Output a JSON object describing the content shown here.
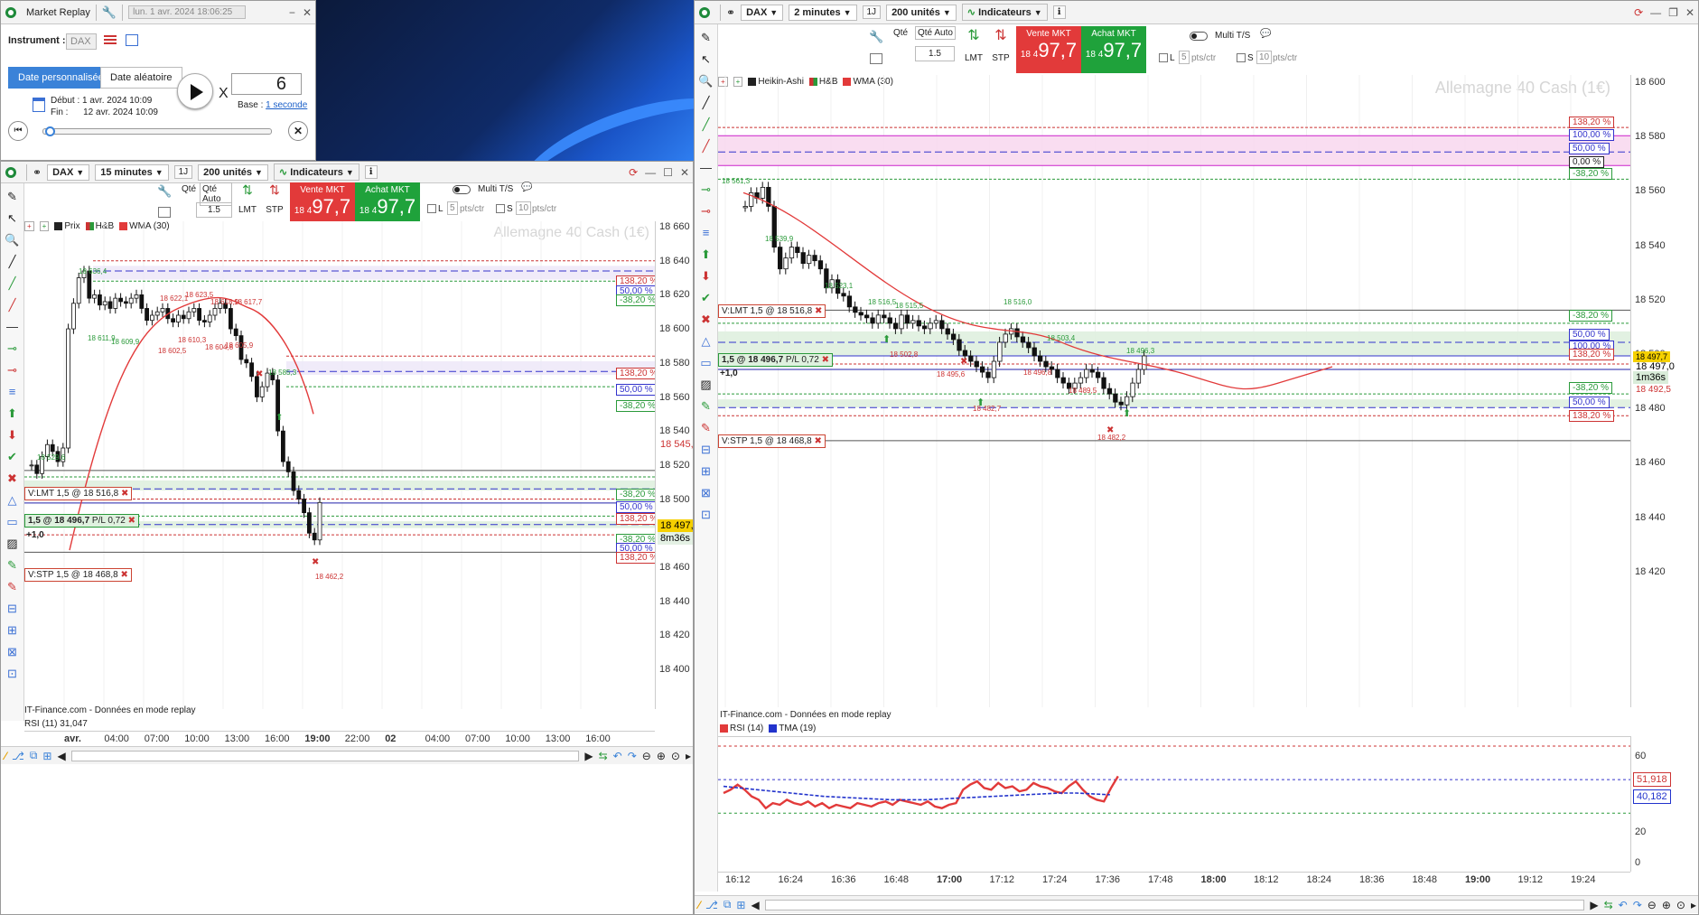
{
  "replay": {
    "title": "Market Replay",
    "datetime": "lun. 1 avr. 2024 18:06:25",
    "instrument_label": "Instrument :",
    "instrument_value": "DAX",
    "tab_custom": "Date personnalisée",
    "tab_random": "Date aléatoire",
    "speed_prefix": "X",
    "speed_value": "6",
    "start_label": "Début :",
    "start_value": "1 avr. 2024 10:09",
    "end_label": "Fin :",
    "end_value": "12 avr. 2024 10:09",
    "base_label": "Base :",
    "base_value": "1 seconde"
  },
  "left": {
    "instrument": "DAX",
    "timeframe": "15 minutes",
    "timeframe_short": "1J",
    "units": "200 unités",
    "indicators": "Indicateurs",
    "qty_label": "Qté",
    "qty_auto": "Qté Auto",
    "qty_value": "1.5",
    "lmt": "LMT",
    "stp": "STP",
    "sell_label": "Vente MKT",
    "sell_price_small": "18 4",
    "sell_price_big": "97,7",
    "buy_label": "Achat MKT",
    "buy_price_small": "18 4",
    "buy_price_big": "97,7",
    "multi_ts": "Multi T/S",
    "l_label": "L",
    "l_value": "5",
    "s_label": "S",
    "s_value": "10",
    "unit": "pts/ctr",
    "legend": [
      "Prix",
      "H&B",
      "WMA (30)"
    ],
    "watermark": "Allemagne 40 Cash (1€)",
    "vlmt": "V:LMT  1,5  @ 18 516,8",
    "pos": "1,5 @ 18 496,7",
    "pl_label": "P/L",
    "pl_value": "0,72",
    "pl_change": "+1,0",
    "vstp": "V:STP  1,5  @ 18 468,8",
    "price_axis": [
      "18 660",
      "18 640",
      "18 620",
      "18 600",
      "18 580",
      "18 560",
      "18 540",
      "18 520",
      "18 500",
      "18 480",
      "18 460",
      "18 440",
      "18 420",
      "18 400"
    ],
    "price_tag_red": "18 545,8",
    "price_tag_cur": "18 497,7",
    "timer": "8m36s",
    "time_axis": [
      "avr.",
      "04:00",
      "07:00",
      "10:00",
      "13:00",
      "16:00",
      "19:00",
      "22:00",
      "02",
      "04:00",
      "07:00",
      "10:00",
      "13:00",
      "16:00"
    ],
    "fib_top": [
      "138,20 %",
      "50,00 %",
      "-38,20 %"
    ],
    "fib_mid": [
      "138,20 %",
      "50,00 %",
      "-38,20 %"
    ],
    "fib_low": [
      "-38,20 %",
      "50,00 %",
      "138,20 %"
    ],
    "fib_bot": [
      "-38,20 %",
      "50,00 %",
      "138,20 %"
    ],
    "annotations": [
      "18 636,4",
      "18 611,9",
      "18 609,9",
      "18 622,1",
      "18 623,5",
      "18 618,9",
      "18 617,7",
      "18 602,5",
      "18 610,3",
      "18 604,8",
      "18 605,9",
      "18 585,3",
      "18 529,6",
      "18 462,2"
    ],
    "source": "IT-Finance.com - Données en mode replay",
    "rsi": "RSI (11) 31,047"
  },
  "right": {
    "instrument": "DAX",
    "timeframe": "2 minutes",
    "timeframe_short": "1J",
    "units": "200 unités",
    "indicators": "Indicateurs",
    "qty_label": "Qté",
    "qty_auto": "Qté Auto",
    "qty_value": "1.5",
    "lmt": "LMT",
    "stp": "STP",
    "sell_label": "Vente MKT",
    "sell_price_small": "18 4",
    "sell_price_big": "97,7",
    "buy_label": "Achat MKT",
    "buy_price_small": "18 4",
    "buy_price_big": "97,7",
    "multi_ts": "Multi T/S",
    "l_label": "L",
    "l_value": "5",
    "s_label": "S",
    "s_value": "10",
    "unit": "pts/ctr",
    "legend": [
      "Heikin-Ashi",
      "H&B",
      "WMA (30)"
    ],
    "watermark": "Allemagne 40 Cash (1€)",
    "vlmt": "V:LMT  1,5  @ 18 516,8",
    "pos": "1,5 @ 18 496,7",
    "pl_label": "P/L",
    "pl_value": "0,72",
    "pl_change": "+1,0",
    "vstp": "V:STP  1,5  @ 18 468,8",
    "price_axis": [
      "18 600",
      "18 580",
      "18 560",
      "18 540",
      "18 520",
      "18 500",
      "18 480",
      "18 460",
      "18 440",
      "18 420"
    ],
    "price_tag_top": "18 497,7",
    "price_tag_cur": "18 497,0",
    "price_tag_low": "18 492,5",
    "timer": "1m36s",
    "time_axis": [
      "16:12",
      "16:24",
      "16:36",
      "16:48",
      "17:00",
      "17:12",
      "17:24",
      "17:36",
      "17:48",
      "18:00",
      "18:12",
      "18:24",
      "18:36",
      "18:48",
      "19:00",
      "19:12",
      "19:24"
    ],
    "fib_top": [
      "138,20 %",
      "100,00 %",
      "50,00 %",
      "0,00 %",
      "-38,20 %"
    ],
    "fib_mid": [
      "-38,20 %",
      "50,00 %",
      "100,00 %",
      "138,20 %"
    ],
    "fib_bot": [
      "-38,20 %",
      "50,00 %",
      "138,20 %"
    ],
    "annotations": [
      "18 561,3",
      "18 539,9",
      "18 523,1",
      "18 516,5",
      "18 515,5",
      "18 516,0",
      "18 502,8",
      "18 503,4",
      "18 495,6",
      "18 496,8",
      "18 489,5",
      "18 496,3",
      "18 482,7",
      "18 482,2"
    ],
    "source": "IT-Finance.com - Données en mode replay",
    "rsi_legend": [
      "RSI (14)",
      "TMA (19)"
    ],
    "rsi_axis": [
      "60",
      "40",
      "20",
      "0"
    ],
    "rsi_tag1": "51,918",
    "rsi_tag2": "40,182"
  }
}
